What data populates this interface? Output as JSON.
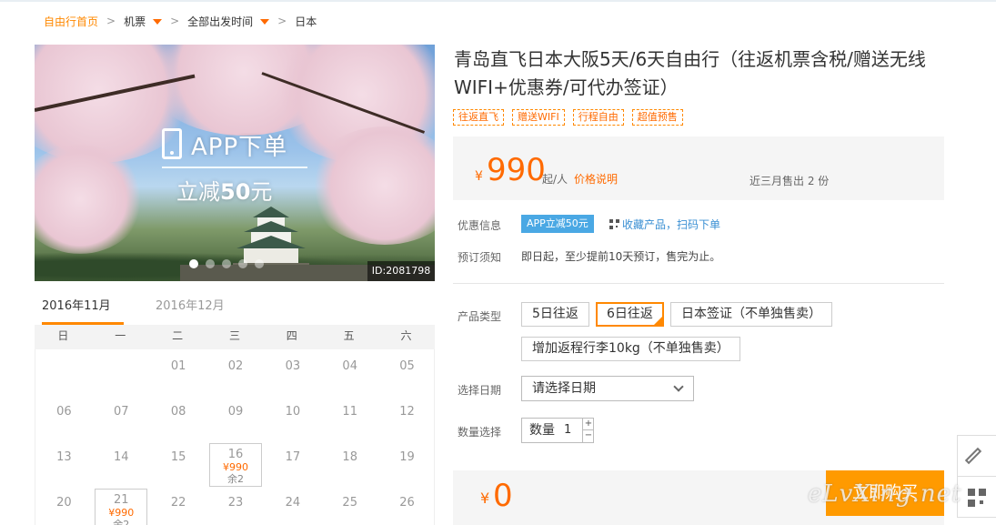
{
  "breadcrumb": {
    "home": "自由行首页",
    "flight": "机票",
    "departure": "全部出发时间",
    "destination": "日本"
  },
  "hero": {
    "app_title": "APP下单",
    "app_sub_prefix": "立减",
    "app_sub_amount": "50",
    "app_sub_suffix": "元",
    "photo_id": "ID:2081798",
    "slides": 5,
    "active_slide": 1
  },
  "calendar": {
    "tabs": [
      "2016年11月",
      "2016年12月"
    ],
    "weekdays": [
      "日",
      "一",
      "二",
      "三",
      "四",
      "五",
      "六"
    ],
    "weeks": [
      [
        "",
        "",
        "01",
        "02",
        "03",
        "04",
        "05"
      ],
      [
        "06",
        "07",
        "08",
        "09",
        "10",
        "11",
        "12"
      ],
      [
        "13",
        "14",
        "15",
        "16",
        "17",
        "18",
        "19"
      ],
      [
        "20",
        "21",
        "22",
        "23",
        "24",
        "25",
        "26"
      ]
    ],
    "available": [
      {
        "day": "16",
        "price": "¥990",
        "remain": "余2"
      },
      {
        "day": "21",
        "price": "¥990",
        "remain": "余2"
      }
    ]
  },
  "product": {
    "title": "青岛直飞日本大阪5天/6天自由行（往返机票含税/赠送无线WIFI+优惠券/可代办签证）",
    "tags": [
      "往返直飞",
      "赠送WIFI",
      "行程自由",
      "超值预售"
    ],
    "currency": "¥",
    "price": "990",
    "price_unit": "起/人",
    "price_explain": "价格说明",
    "sold": "近三月售出 2 份"
  },
  "info": {
    "promo_label": "优惠信息",
    "promo_badge": "APP立减50元",
    "collect_link": "收藏产品，扫码下单",
    "notice_label": "预订须知",
    "notice_text": "即日起，至少提前10天预订，售完为止。"
  },
  "options": {
    "type_label": "产品类型",
    "types": [
      "5日往返",
      "6日往返",
      "日本签证（不单独售卖）",
      "增加返程行李10kg（不单独售卖）"
    ],
    "selected_type": "6日往返",
    "date_label": "选择日期",
    "date_placeholder": "请选择日期",
    "qty_label": "数量选择",
    "qty_inner_label": "数量",
    "qty_value": "1",
    "plus": "+",
    "minus": "−"
  },
  "footer": {
    "currency": "¥",
    "total": "0",
    "buy_label": "立即购买"
  },
  "watermark": "eLvXing.net",
  "colors": {
    "accent": "#ff8800",
    "price": "#ff6a00",
    "promo": "#4aa8e4",
    "link": "#3a8fd3"
  }
}
